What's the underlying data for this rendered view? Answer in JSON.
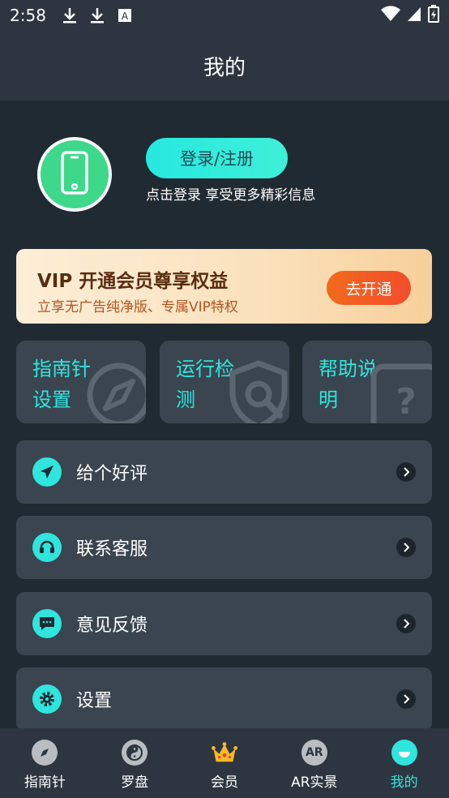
{
  "status": {
    "time": "2:58",
    "left_icons": [
      "download-icon",
      "download-icon",
      "text-a-icon"
    ],
    "right_icons": [
      "wifi-icon",
      "signal-icon",
      "battery-icon"
    ]
  },
  "header": {
    "title": "我的"
  },
  "profile": {
    "login_label": "登录/注册",
    "login_tip": "点击登录 享受更多精彩信息",
    "avatar_icon": "phone-icon"
  },
  "vip": {
    "title": "VIP 开通会员尊享权益",
    "subtitle": "立享无广告纯净版、专属VIP特权",
    "button": "去开通"
  },
  "tiles": [
    {
      "label": "指南针设置",
      "icon": "compass-icon"
    },
    {
      "label": "运行检测",
      "icon": "shield-search-icon"
    },
    {
      "label": "帮助说明",
      "icon": "help-icon"
    }
  ],
  "menu": [
    {
      "label": "给个好评",
      "icon": "paper-plane-icon"
    },
    {
      "label": "联系客服",
      "icon": "headset-icon"
    },
    {
      "label": "意见反馈",
      "icon": "chat-icon"
    },
    {
      "label": "设置",
      "icon": "gear-icon"
    }
  ],
  "tabs": [
    {
      "label": "指南针",
      "icon": "compass-icon"
    },
    {
      "label": "罗盘",
      "icon": "yin-yang-icon"
    },
    {
      "label": "会员",
      "icon": "crown-icon"
    },
    {
      "label": "AR实景",
      "icon": "ar-icon",
      "icon_text": "AR"
    },
    {
      "label": "我的",
      "icon": "smile-icon",
      "active": true
    }
  ],
  "colors": {
    "accent": "#2fe5dd",
    "background": "#202a32",
    "bar": "#2d3640",
    "card": "#3a4550",
    "vip_button": "#f24d2c"
  }
}
